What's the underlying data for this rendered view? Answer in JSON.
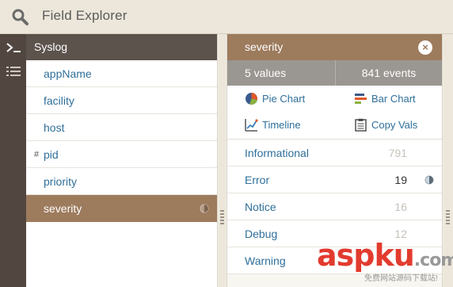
{
  "header": {
    "title": "Field Explorer",
    "icon": "search-icon"
  },
  "rail": {
    "items": [
      {
        "icon": "terminal-icon"
      },
      {
        "icon": "list-icon"
      }
    ]
  },
  "fields": {
    "group_label": "Syslog",
    "items": [
      {
        "label": "appName",
        "prefix": ""
      },
      {
        "label": "facility",
        "prefix": ""
      },
      {
        "label": "host",
        "prefix": ""
      },
      {
        "label": "pid",
        "prefix": "#"
      },
      {
        "label": "priority",
        "prefix": ""
      },
      {
        "label": "severity",
        "prefix": "",
        "selected": true
      }
    ]
  },
  "detail": {
    "field_name": "severity",
    "close_glyph": "×",
    "values_summary": "5 values",
    "events_summary": "841 events",
    "actions": {
      "pie_chart": "Pie Chart",
      "bar_chart": "Bar Chart",
      "timeline": "Timeline",
      "copy_vals": "Copy Vals"
    },
    "values": [
      {
        "label": "Informational",
        "count": "791",
        "active": false
      },
      {
        "label": "Error",
        "count": "19",
        "active": true
      },
      {
        "label": "Notice",
        "count": "16",
        "active": false
      },
      {
        "label": "Debug",
        "count": "12",
        "active": false
      },
      {
        "label": "Warning",
        "count": "",
        "active": false
      }
    ]
  },
  "watermark": {
    "brand": "asp",
    "brand_ku": "ku",
    "brand_tld": ".com",
    "tagline": "免费网站源码下载站!"
  },
  "colors": {
    "accent_brown": "#9d7b5d",
    "dark_header": "#5d534d",
    "link_blue": "#2f6f9a"
  }
}
